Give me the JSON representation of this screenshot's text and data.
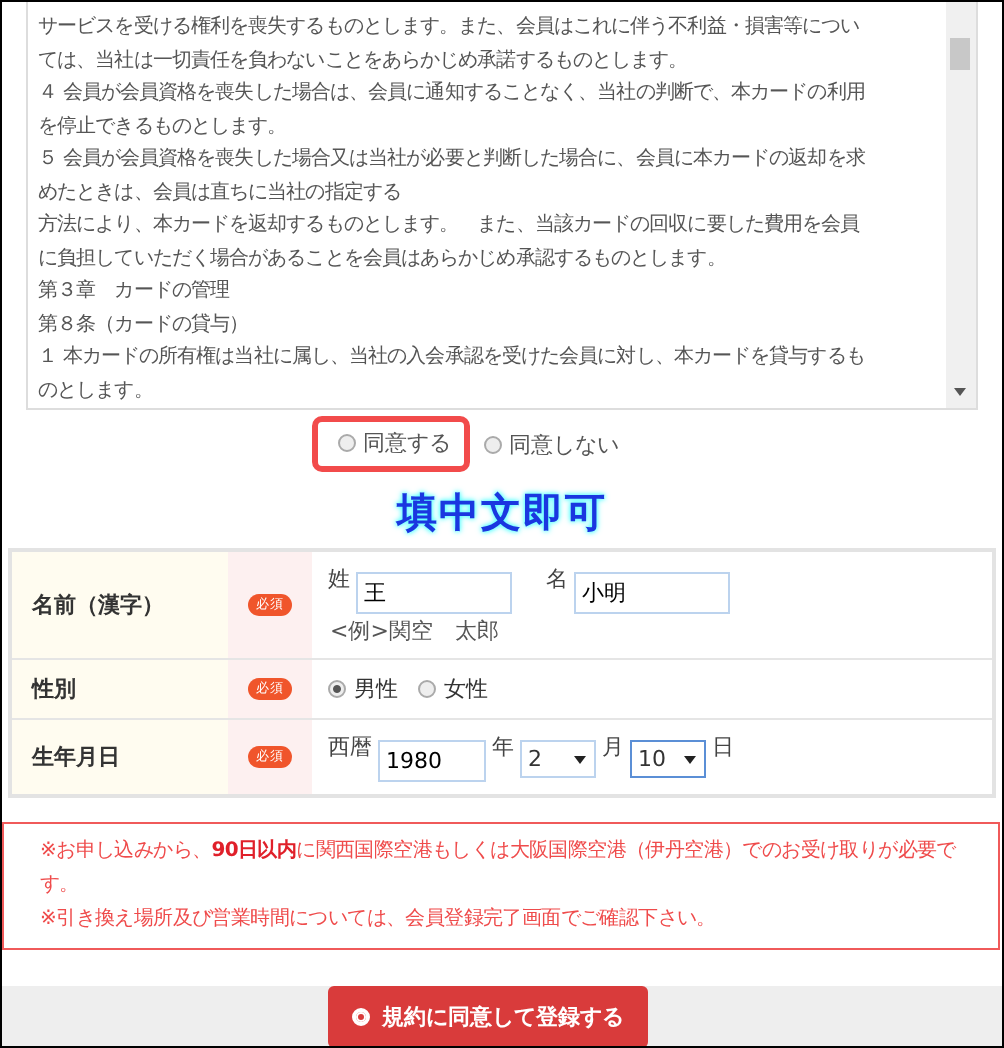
{
  "terms": {
    "lines": [
      "サービスを受ける権利を喪失するものとします。また、会員はこれに伴う不利益・損害等につい",
      "ては、当社は一切責任を負わないことをあらかじめ承諾するものとします。",
      "４ 会員が会員資格を喪失した場合は、会員に通知することなく、当社の判断で、本カードの利用",
      "を停止できるものとします。",
      "５ 会員が会員資格を喪失した場合又は当社が必要と判断した場合に、会員に本カードの返却を求",
      "めたときは、会員は直ちに当社の指定する",
      "方法により、本カードを返却するものとします。　また、当該カードの回収に要した費用を会員",
      "に負担していただく場合があることを会員はあらかじめ承認するものとします。",
      "第３章　カードの管理",
      "第８条（カードの貸与）",
      "１ 本カードの所有権は当社に属し、当社の入会承認を受けた会員に対し、本カードを貸与するも",
      "のとします。"
    ]
  },
  "agreement": {
    "options": [
      {
        "label": "同意する",
        "selected": false,
        "highlighted": true
      },
      {
        "label": "同意しない",
        "selected": false,
        "highlighted": false
      }
    ]
  },
  "annotation": "填中文即可",
  "form": {
    "rows": [
      {
        "kind": "name",
        "label": "名前（漢字）",
        "required": "必須",
        "last_label": "姓",
        "last_value": "王",
        "first_label": "名",
        "first_value": "小明",
        "example": "<例>関空　太郎"
      },
      {
        "kind": "gender",
        "label": "性別",
        "required": "必須",
        "options": [
          {
            "label": "男性",
            "selected": true
          },
          {
            "label": "女性",
            "selected": false
          }
        ]
      },
      {
        "kind": "birth",
        "label": "生年月日",
        "required": "必須",
        "era": "西暦",
        "year": "1980",
        "year_unit": "年",
        "month": "2",
        "month_unit": "月",
        "day": "10",
        "day_unit": "日"
      }
    ]
  },
  "notice": [
    "※お申し込みから、**90日以内**に関西国際空港もしくは大阪国際空港（伊丹空港）でのお受け取りが必要です。",
    "※引き換え場所及び営業時間については、会員登録完了画面でご確認下さい。"
  ],
  "submit": "規約に同意して登録する"
}
